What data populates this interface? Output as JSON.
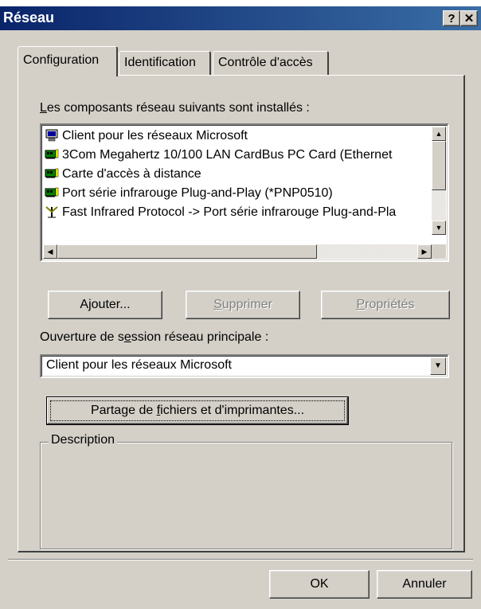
{
  "window": {
    "title": "Réseau",
    "help_btn": "?",
    "close_btn": "✕"
  },
  "tabs": [
    {
      "label": "Configuration",
      "active": true
    },
    {
      "label": "Identification",
      "active": false
    },
    {
      "label": "Contrôle d'accès",
      "active": false
    }
  ],
  "components": {
    "label_ul": "L",
    "label_rest": "es composants réseau suivants sont installés :",
    "items": [
      {
        "label": "Client pour les réseaux Microsoft",
        "icon": "network-client-icon"
      },
      {
        "label": "3Com Megahertz 10/100 LAN CardBus PC Card (Ethernet",
        "icon": "network-adapter-icon"
      },
      {
        "label": "Carte d'accès à distance",
        "icon": "network-adapter-icon"
      },
      {
        "label": "Port série infrarouge Plug-and-Play (*PNP0510)",
        "icon": "network-adapter-icon"
      },
      {
        "label": "Fast Infrared Protocol -> Port série infrarouge Plug-and-Pla",
        "icon": "protocol-icon"
      }
    ]
  },
  "buttons": {
    "add_pre": "A",
    "add_ul": "j",
    "add_post": "outer...",
    "remove_ul": "S",
    "remove_post": "upprimer",
    "properties_ul": "P",
    "properties_post": "ropriétés",
    "share_pre": "Partage de ",
    "share_ul": "f",
    "share_post": "ichiers et d'imprimantes...",
    "ok": "OK",
    "cancel": "Annuler"
  },
  "logon": {
    "label_pre": "Ouverture de s",
    "label_ul": "e",
    "label_post": "ssion réseau principale :",
    "value": "Client pour les réseaux Microsoft"
  },
  "description": {
    "title": "Description"
  }
}
